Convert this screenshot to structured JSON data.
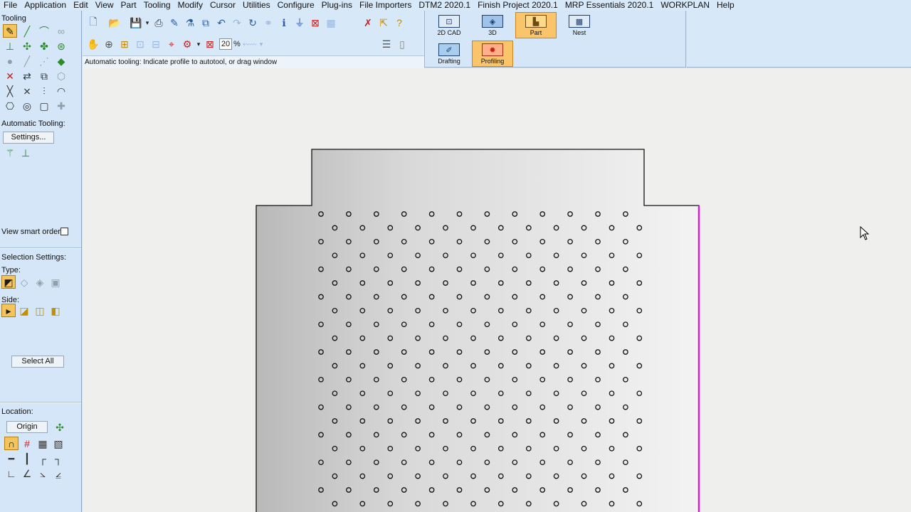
{
  "menu": [
    "File",
    "Application",
    "Edit",
    "View",
    "Part",
    "Tooling",
    "Modify",
    "Cursor",
    "Utilities",
    "Configure",
    "Plug-ins",
    "File Importers",
    "DTM2 2020.1",
    "Finish Project 2020.1",
    "MRP Essentials 2020.1",
    "WORKPLAN",
    "Help"
  ],
  "left_panel": {
    "tooling_label": "Tooling",
    "automatic_tooling_label": "Automatic Tooling:",
    "settings_button": "Settings...",
    "view_smart_order_label": "View smart order:",
    "view_smart_order_checked": false,
    "selection_settings_label": "Selection Settings:",
    "type_label": "Type:",
    "side_label": "Side:",
    "select_all_button": "Select All",
    "location_label": "Location:",
    "origin_button": "Origin"
  },
  "toolbar": {
    "zoom_value": "20",
    "zoom_unit": "%",
    "status_text": "Automatic tooling: Indicate profile to autotool, or drag window"
  },
  "modes": {
    "cad2d": "2D CAD",
    "threed": "3D",
    "part": "Part",
    "nest": "Nest",
    "drafting": "Drafting",
    "profiling": "Profiling",
    "active": [
      "part",
      "profiling"
    ]
  },
  "colors": {
    "active_button": "#f9c46a",
    "edge_highlight": "#d61fd6",
    "panel_bg": "#d4e6f7"
  }
}
